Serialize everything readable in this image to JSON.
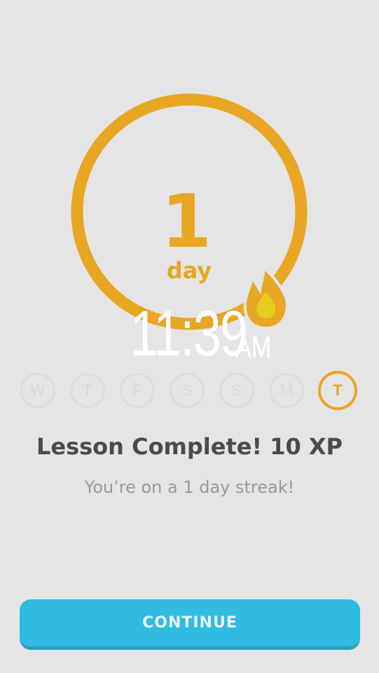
{
  "streak": {
    "count": "1",
    "unit": "day"
  },
  "clock": {
    "time": "11:39",
    "period": "AM"
  },
  "week": {
    "days": [
      "W",
      "T",
      "F",
      "S",
      "S",
      "M",
      "T"
    ],
    "active_index": 6
  },
  "result": {
    "title": "Lesson Complete! 10 XP",
    "subtitle": "You’re on a 1 day streak!"
  },
  "actions": {
    "continue_label": "CONTINUE"
  },
  "colors": {
    "background": "#e5e5e5",
    "streak_orange": "#e8a623",
    "flame_yellow": "#e6cc1c",
    "inactive_day": "#dcdcdc",
    "title_text": "#4b4b4b",
    "subtitle_text": "#9a9a9a",
    "continue_button": "#30bbe2"
  }
}
